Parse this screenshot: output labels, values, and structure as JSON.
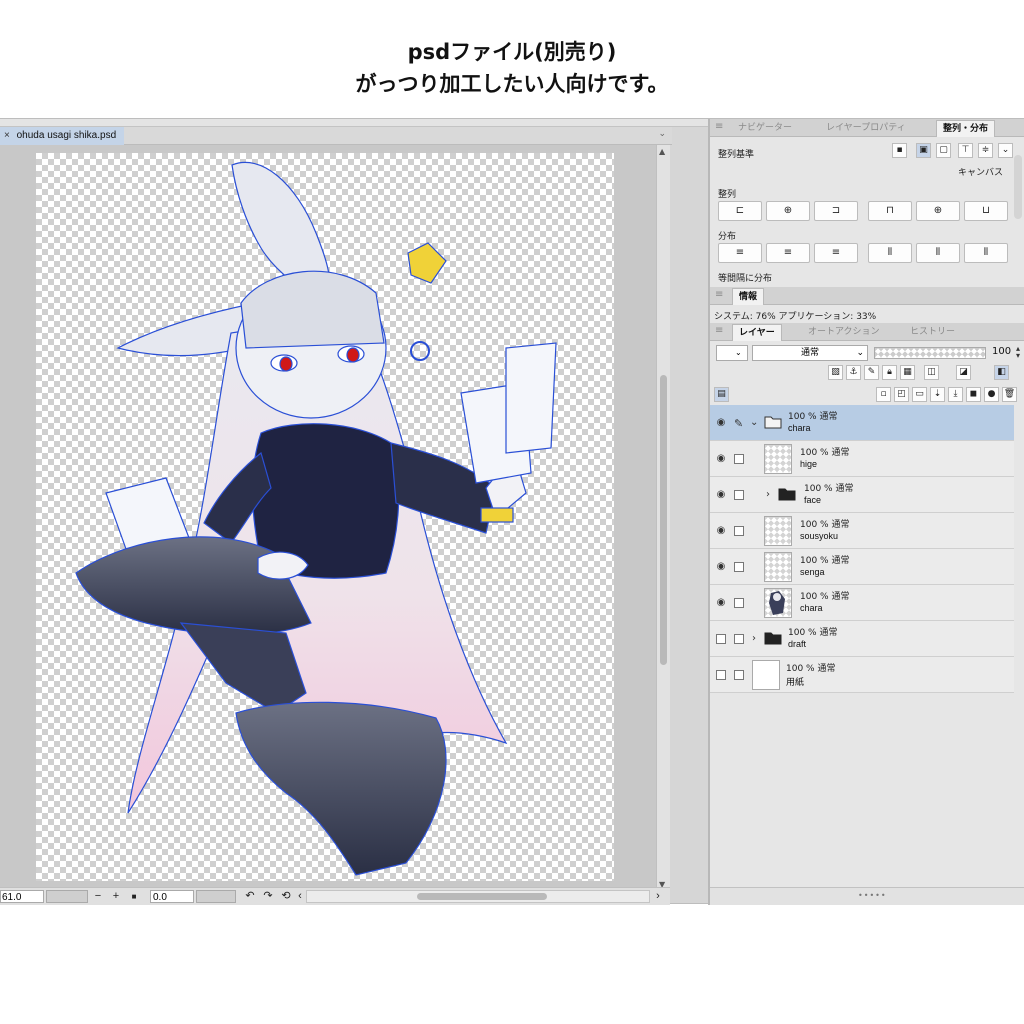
{
  "caption": {
    "line1": "psdファイル(別売り)",
    "line2": "がっつり加工したい人向けです。"
  },
  "document": {
    "tab_name": "ohuda usagi shika.psd",
    "close_glyph": "×"
  },
  "status_bar": {
    "zoom": "61.0",
    "zoom_out": "−",
    "zoom_in": "+",
    "fit": "■",
    "angle": "0.0",
    "rotate_left": "↶",
    "rotate_right": "↷",
    "reset": "⟲",
    "scroll_left": "‹",
    "scroll_right": "›"
  },
  "panels": {
    "tabs_top": [
      {
        "label": "ナビゲーター",
        "active": false
      },
      {
        "label": "レイヤープロパティ",
        "active": false
      },
      {
        "label": "整列・分布",
        "active": true
      }
    ],
    "align": {
      "basis_label": "整列基準",
      "basis_value": "キャンバス",
      "align_label": "整列",
      "distribute_label": "分布",
      "even_label": "等間隔に分布"
    },
    "info": {
      "tab_label": "情報",
      "text": "システム: 76%  アプリケーション: 33%"
    },
    "tabs_layer": [
      {
        "label": "レイヤー",
        "active": true
      },
      {
        "label": "オートアクション",
        "active": false
      },
      {
        "label": "ヒストリー",
        "active": false
      }
    ],
    "layer_controls": {
      "blend_mode": "通常",
      "opacity": "100"
    },
    "layers": [
      {
        "mode": "100 %  通常",
        "name": "chara",
        "type": "folder",
        "selected": true,
        "visible": true,
        "indent": 0,
        "expanded": true
      },
      {
        "mode": "100 %  通常",
        "name": "hige",
        "type": "raster",
        "selected": false,
        "visible": true,
        "indent": 1
      },
      {
        "mode": "100 %  通常",
        "name": "face",
        "type": "folder",
        "selected": false,
        "visible": true,
        "indent": 1,
        "expanded": false
      },
      {
        "mode": "100 %  通常",
        "name": "sousyoku",
        "type": "raster",
        "selected": false,
        "visible": true,
        "indent": 1
      },
      {
        "mode": "100 %  通常",
        "name": "senga",
        "type": "raster",
        "selected": false,
        "visible": true,
        "indent": 1
      },
      {
        "mode": "100 %  通常",
        "name": "chara",
        "type": "raster-art",
        "selected": false,
        "visible": true,
        "indent": 1
      },
      {
        "mode": "100 %  通常",
        "name": "draft",
        "type": "folder",
        "selected": false,
        "visible": false,
        "indent": 0,
        "expanded": false
      },
      {
        "mode": "100 %  通常",
        "name": "用紙",
        "type": "paper",
        "selected": false,
        "visible": false,
        "indent": 0
      }
    ]
  },
  "colors": {
    "selection": "#b7cce4",
    "accent_blue": "#2a4fd6"
  }
}
